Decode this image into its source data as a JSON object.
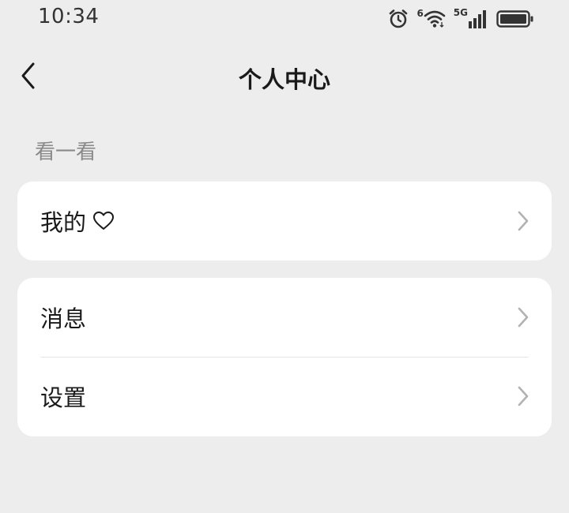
{
  "status_bar": {
    "time": "10:34",
    "wifi_badge": "6",
    "network": "5G",
    "icons": [
      "alarm-icon",
      "wifi-icon",
      "signal-icon",
      "battery-icon"
    ]
  },
  "header": {
    "title": "个人中心",
    "back_icon": "chevron-left-icon"
  },
  "section": {
    "label": "看一看"
  },
  "cards": [
    {
      "rows": [
        {
          "label": "我的",
          "icon": "heart-outline-icon",
          "trailing": "chevron-right-icon"
        }
      ]
    },
    {
      "rows": [
        {
          "label": "消息",
          "trailing": "chevron-right-icon"
        },
        {
          "label": "设置",
          "trailing": "chevron-right-icon"
        }
      ]
    }
  ],
  "colors": {
    "background": "#ededed",
    "card": "#ffffff",
    "primary_text": "#1a1a1a",
    "secondary_text": "#8a8a8a",
    "chevron": "#b2b2b2",
    "divider": "#e6e6e6"
  }
}
